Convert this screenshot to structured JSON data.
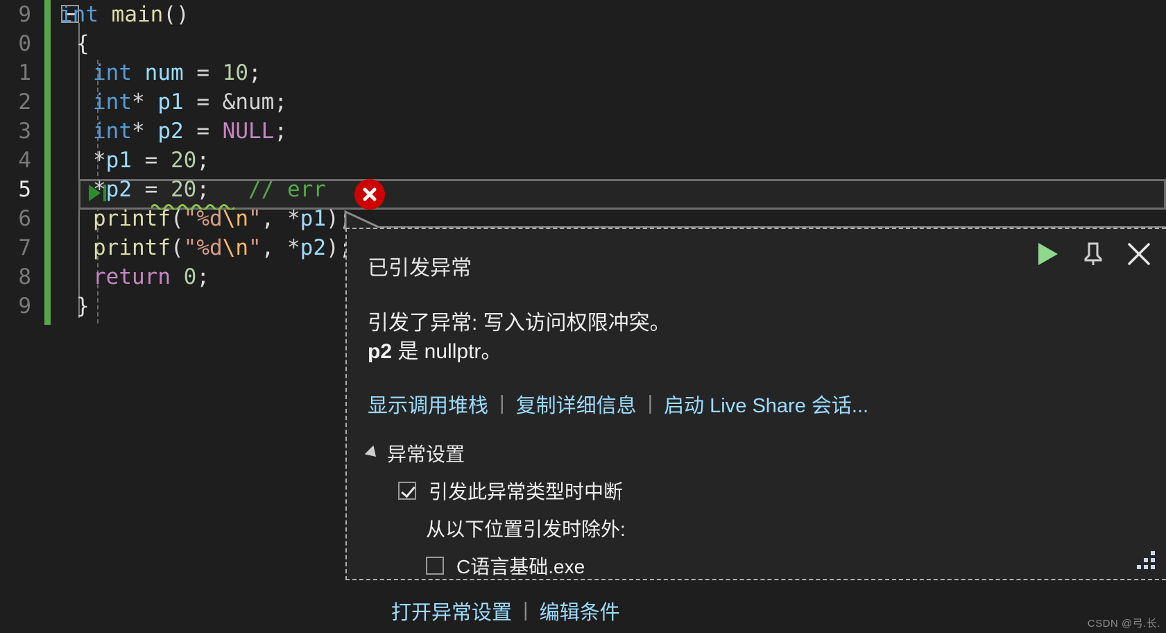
{
  "editor": {
    "line_numbers": [
      "9",
      "0",
      "1",
      "2",
      "3",
      "4",
      "5",
      "6",
      "7",
      "8",
      "9"
    ],
    "current_line_index": 6,
    "lines": [
      {
        "indent": 0,
        "tokens": [
          {
            "t": "int",
            "c": "type"
          },
          {
            "t": " ",
            "c": "op"
          },
          {
            "t": "main",
            "c": "fn"
          },
          {
            "t": "()",
            "c": "punc"
          }
        ]
      },
      {
        "indent": 1,
        "tokens": [
          {
            "t": "{",
            "c": "punc"
          }
        ]
      },
      {
        "indent": 2,
        "tokens": [
          {
            "t": "int",
            "c": "type"
          },
          {
            "t": " ",
            "c": "op"
          },
          {
            "t": "num",
            "c": "id"
          },
          {
            "t": " = ",
            "c": "op"
          },
          {
            "t": "10",
            "c": "num"
          },
          {
            "t": ";",
            "c": "punc"
          }
        ]
      },
      {
        "indent": 2,
        "tokens": [
          {
            "t": "int",
            "c": "type"
          },
          {
            "t": "* ",
            "c": "op"
          },
          {
            "t": "p1",
            "c": "id"
          },
          {
            "t": " = ",
            "c": "op"
          },
          {
            "t": "&num",
            "c": "op"
          },
          {
            "t": ";",
            "c": "punc"
          }
        ]
      },
      {
        "indent": 2,
        "tokens": [
          {
            "t": "int",
            "c": "type"
          },
          {
            "t": "* ",
            "c": "op"
          },
          {
            "t": "p2",
            "c": "id"
          },
          {
            "t": " = ",
            "c": "op"
          },
          {
            "t": "NULL",
            "c": "mac"
          },
          {
            "t": ";",
            "c": "punc"
          }
        ]
      },
      {
        "indent": 2,
        "tokens": [
          {
            "t": "*",
            "c": "op"
          },
          {
            "t": "p1",
            "c": "id"
          },
          {
            "t": " = ",
            "c": "op"
          },
          {
            "t": "20",
            "c": "num"
          },
          {
            "t": ";",
            "c": "punc"
          }
        ]
      },
      {
        "indent": 2,
        "tokens": [
          {
            "t": "*",
            "c": "op"
          },
          {
            "t": "p2",
            "c": "id"
          },
          {
            "t": " = ",
            "c": "op"
          },
          {
            "t": "20",
            "c": "num"
          },
          {
            "t": ";",
            "c": "punc"
          },
          {
            "t": "   ",
            "c": "op"
          },
          {
            "t": "// err",
            "c": "cmt"
          }
        ]
      },
      {
        "indent": 2,
        "tokens": [
          {
            "t": "printf",
            "c": "fn"
          },
          {
            "t": "(",
            "c": "punc"
          },
          {
            "t": "\"%d",
            "c": "str"
          },
          {
            "t": "\\n",
            "c": "esc"
          },
          {
            "t": "\"",
            "c": "str"
          },
          {
            "t": ", ",
            "c": "punc"
          },
          {
            "t": "*",
            "c": "op"
          },
          {
            "t": "p1",
            "c": "id"
          },
          {
            "t": ");",
            "c": "punc"
          }
        ]
      },
      {
        "indent": 2,
        "tokens": [
          {
            "t": "printf",
            "c": "fn"
          },
          {
            "t": "(",
            "c": "punc"
          },
          {
            "t": "\"%d",
            "c": "str"
          },
          {
            "t": "\\n",
            "c": "esc"
          },
          {
            "t": "\"",
            "c": "str"
          },
          {
            "t": ", ",
            "c": "punc"
          },
          {
            "t": "*",
            "c": "op"
          },
          {
            "t": "p2",
            "c": "id"
          },
          {
            "t": ");",
            "c": "punc"
          }
        ]
      },
      {
        "indent": 2,
        "tokens": [
          {
            "t": "return",
            "c": "ctrl"
          },
          {
            "t": " ",
            "c": "op"
          },
          {
            "t": "0",
            "c": "num"
          },
          {
            "t": ";",
            "c": "punc"
          }
        ]
      },
      {
        "indent": 1,
        "tokens": [
          {
            "t": "}",
            "c": "punc"
          }
        ]
      }
    ]
  },
  "error_marker": {
    "icon": "error-circle-x-icon",
    "color": "#cf0000"
  },
  "popup": {
    "title": "已引发异常",
    "message_line1": "引发了异常: 写入访问权限冲突。",
    "message_line2_bold": "p2",
    "message_line2_rest": " 是 nullptr。",
    "links": [
      {
        "label": "显示调用堆栈",
        "name": "show-call-stack-link"
      },
      {
        "label": "复制详细信息",
        "name": "copy-details-link"
      },
      {
        "label": "启动 Live Share 会话...",
        "name": "start-live-share-link"
      }
    ],
    "separator": "|",
    "settings_section": {
      "header": "异常设置",
      "expanded": true,
      "break_when_thrown": {
        "label": "引发此异常类型时中断",
        "checked": true
      },
      "except_when_thrown_from": "从以下位置引发时除外:",
      "modules": [
        {
          "label": "C语言基础.exe",
          "checked": false
        }
      ]
    },
    "bottom_links": [
      {
        "label": "打开异常设置",
        "name": "open-exception-settings-link"
      },
      {
        "label": "编辑条件",
        "name": "edit-conditions-link"
      }
    ],
    "controls": [
      {
        "name": "continue-execution-button",
        "icon": "play-icon",
        "color": "#8ed98e"
      },
      {
        "name": "pin-button",
        "icon": "pin-icon",
        "color": "#cfcfcf"
      },
      {
        "name": "close-button",
        "icon": "close-x-icon",
        "color": "#e6e6e6"
      }
    ]
  },
  "watermark": "CSDN @弓.长."
}
